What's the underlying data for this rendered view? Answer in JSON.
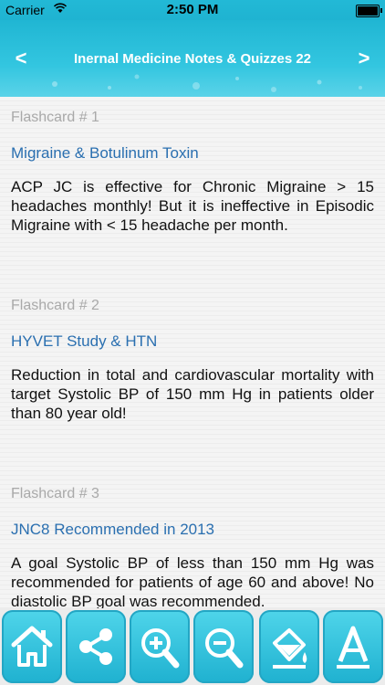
{
  "status_bar": {
    "carrier": "Carrier",
    "wifi_icon": "wifi-icon",
    "time": "2:50 PM",
    "battery_icon": "battery-icon"
  },
  "nav": {
    "title": "Inernal Medicine Notes & Quizzes 22",
    "back_glyph": "<",
    "next_glyph": ">"
  },
  "flashcards": [
    {
      "label": "Flashcard # 1",
      "title": "Migraine & Botulinum Toxin",
      "body": "ACP JC is effective for Chronic Migraine > 15 headaches monthly! But it is ineffective in Episodic Migraine with < 15 headache per month."
    },
    {
      "label": "Flashcard # 2",
      "title": "HYVET Study & HTN",
      "body": "Reduction in total and cardiovascular mortality with target Systolic BP of 150 mm Hg in patients older than 80 year old!"
    },
    {
      "label": "Flashcard # 3",
      "title": "JNC8 Recommended in 2013",
      "body": "A goal Systolic BP of less than 150 mm Hg was recommended for patients of age 60 and above! No diastolic BP goal was recommended."
    }
  ],
  "toolbar": {
    "buttons": [
      "home-icon",
      "share-icon",
      "zoom-in-icon",
      "zoom-out-icon",
      "paint-bucket-icon",
      "font-icon"
    ]
  },
  "colors": {
    "accent": "#22b9d6",
    "title_blue": "#2a6fb0",
    "label_gray": "#a9a9a9"
  }
}
